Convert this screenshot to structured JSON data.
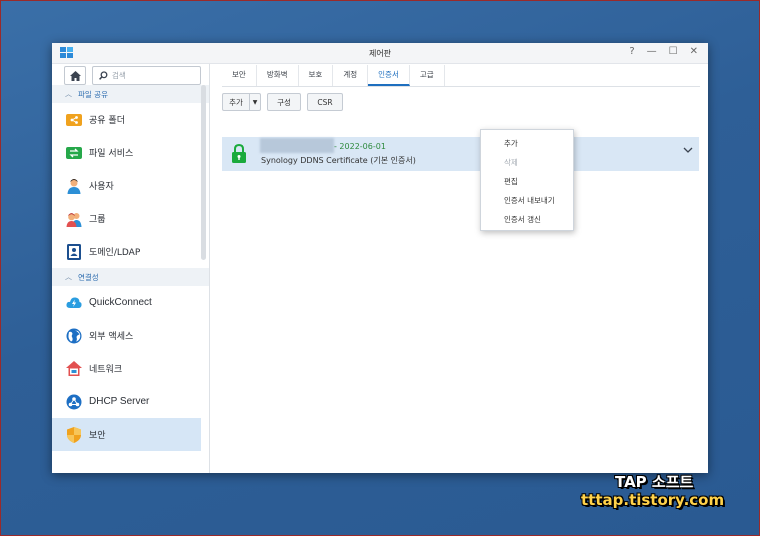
{
  "window": {
    "title": "제어판",
    "controls": [
      "?",
      "—",
      "☐",
      "✕"
    ]
  },
  "sidebar": {
    "search_placeholder": "검색",
    "sections": [
      {
        "label": "파일 공유",
        "items": [
          {
            "label": "공유 폴더",
            "icon": "shared-folder-icon"
          },
          {
            "label": "파일 서비스",
            "icon": "file-services-icon"
          },
          {
            "label": "사용자",
            "icon": "user-icon"
          },
          {
            "label": "그룹",
            "icon": "group-icon"
          },
          {
            "label": "도메인/LDAP",
            "icon": "domain-ldap-icon"
          }
        ]
      },
      {
        "label": "연결성",
        "items": [
          {
            "label": "QuickConnect",
            "icon": "quickconnect-icon"
          },
          {
            "label": "외부 액세스",
            "icon": "external-access-icon"
          },
          {
            "label": "네트워크",
            "icon": "network-icon"
          },
          {
            "label": "DHCP Server",
            "icon": "dhcp-icon"
          },
          {
            "label": "보안",
            "icon": "security-icon",
            "active": true
          }
        ]
      }
    ]
  },
  "tabs": [
    {
      "label": "보안"
    },
    {
      "label": "방화벽"
    },
    {
      "label": "보호"
    },
    {
      "label": "계정"
    },
    {
      "label": "인증서",
      "active": true
    },
    {
      "label": "고급"
    }
  ],
  "toolbar": {
    "add_label": "추가",
    "configure_label": "구성",
    "csr_label": "CSR"
  },
  "certificate": {
    "date": "- 2022-06-01",
    "name": "Synology DDNS Certificate (기본 인증서)"
  },
  "context_menu": {
    "items": [
      {
        "label": "추가",
        "disabled": false
      },
      {
        "label": "삭제",
        "disabled": true
      },
      {
        "label": "편집",
        "disabled": false
      },
      {
        "label": "인증서 내보내기",
        "disabled": false
      },
      {
        "label": "인증서 갱신",
        "disabled": false
      }
    ]
  },
  "watermark": {
    "line1": "TAP 소프트",
    "line2": "tttap.tistory.com"
  },
  "colors": {
    "accent": "#1e6fbf",
    "selected_row": "#d9e7f5",
    "lock_green": "#1aaa3c",
    "date_green": "#2e8a3e"
  }
}
